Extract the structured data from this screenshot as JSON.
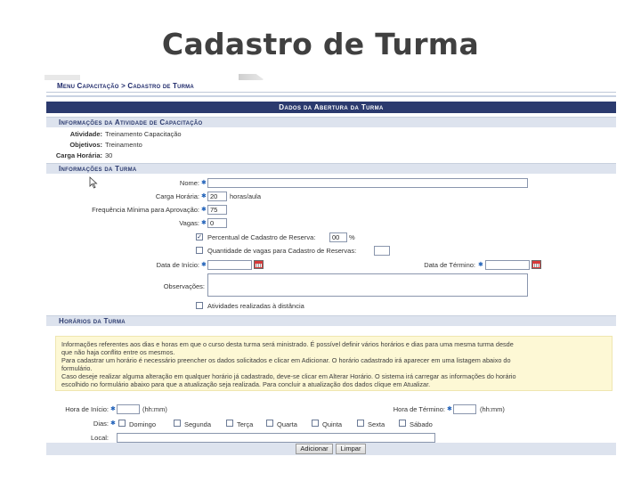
{
  "slide": {
    "title": "Cadastro de Turma"
  },
  "breadcrumb": "Menu Capacitação > Cadastro de Turma",
  "form": {
    "header": "Dados da Abertura da Turma",
    "activity_section": {
      "title": "Informações da Atividade de Capacitação",
      "atividade_label": "Atividade:",
      "atividade_value": "Treinamento Capacitação",
      "objetivos_label": "Objetivos:",
      "objetivos_value": "Treinamento",
      "carga_label": "Carga Horária:",
      "carga_value": "30"
    },
    "class_section": {
      "title": "Informações da Turma",
      "nome_label": "Nome:",
      "nome_value": "",
      "carga_horaria_label": "Carga Horária:",
      "carga_horaria_value": "20",
      "carga_horaria_unit": "horas/aula",
      "frequencia_label": "Frequência Mínima para Aprovação:",
      "frequencia_value": "75",
      "vagas_label": "Vagas:",
      "vagas_value": "0",
      "reserva_label": "Percentual de Cadastro de Reserva:",
      "reserva_value": "00",
      "reserva_unit": "%",
      "qtd_vagas_label": "Quantidade de vagas para Cadastro de Reservas:",
      "qtd_vagas_value": "",
      "data_inicio_label": "Data de Início:",
      "data_inicio_value": "",
      "data_termino_label": "Data de Término:",
      "data_termino_value": "",
      "observacoes_label": "Observações:",
      "observacoes_value": "",
      "distancia_label": "Atividades realizadas à distância"
    },
    "schedule_section": {
      "title": "Horários da Turma",
      "info_lines": [
        "Informações referentes aos dias e horas em que o curso desta turma será ministrado. É possível definir vários horários e dias para uma mesma turma desde",
        "que não haja conflito entre os mesmos.",
        "Para cadastrar um horário é necessário preencher os dados solicitados e clicar em Adicionar. O horário cadastrado irá aparecer em uma listagem abaixo do",
        "formulário.",
        "Caso deseje realizar alguma alteração em qualquer horário já cadastrado, deve-se clicar em Alterar Horário. O sistema irá carregar as informações do horário",
        "escolhido no formulário abaixo para que a atualização seja realizada. Para concluir a atualização dos dados clique em Atualizar."
      ],
      "hora_inicio_label": "Hora de Início:",
      "hora_inicio_value": "",
      "hora_inicio_hint": "(hh:mm)",
      "hora_termino_label": "Hora de Término:",
      "hora_termino_value": "",
      "hora_termino_hint": "(hh:mm)",
      "dias_label": "Dias:",
      "days": [
        "Domingo",
        "Segunda",
        "Terça",
        "Quarta",
        "Quinta",
        "Sexta",
        "Sábado"
      ],
      "local_label": "Local:",
      "local_value": ""
    },
    "buttons": {
      "adicionar": "Adicionar",
      "limpar": "Limpar"
    }
  }
}
